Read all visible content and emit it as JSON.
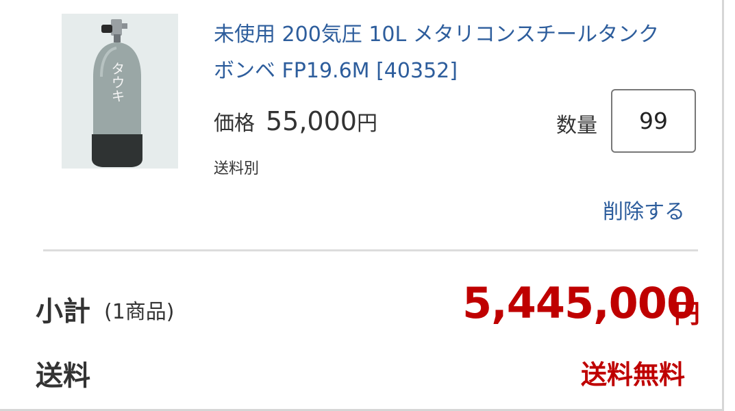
{
  "item": {
    "title": "未使用 200気圧 10L メタリコンスチールタンク ボンベ FP19.6M [40352]",
    "image_text": "タウキ",
    "price_label": "価格",
    "price_value": "55,000",
    "price_unit": "円",
    "shipping_note": "送料別",
    "quantity_label": "数量",
    "quantity_value": "99",
    "delete_label": "削除する"
  },
  "summary": {
    "subtotal_label": "小計",
    "subtotal_count": "(1商品)",
    "subtotal_value": "5,445,000",
    "subtotal_unit": "円",
    "shipping_label": "送料",
    "shipping_value": "送料無料"
  },
  "colors": {
    "link": "#2d5d9c",
    "price_red": "#bf0000",
    "text": "#333333"
  },
  "icons": {
    "product_image": "scuba-tank-photo"
  }
}
